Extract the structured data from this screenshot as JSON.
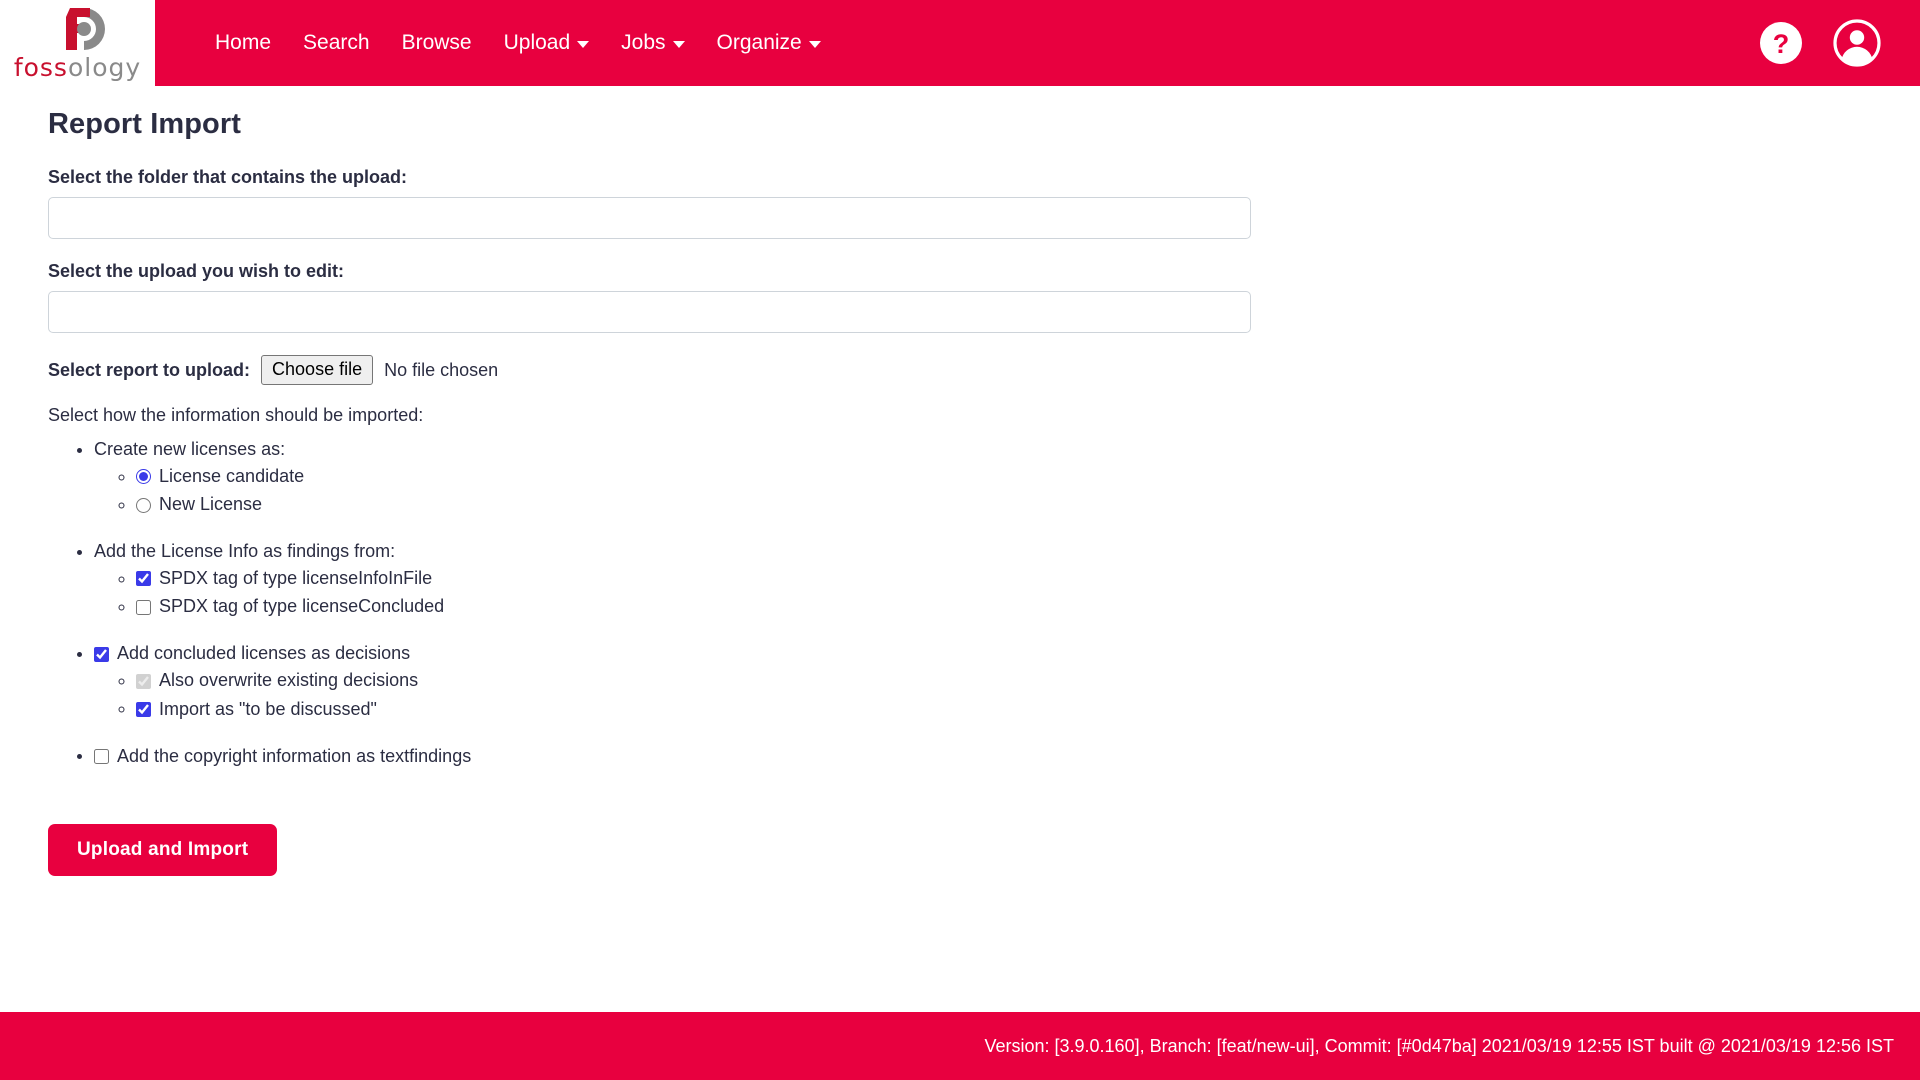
{
  "header": {
    "brand": {
      "logo_icon": "fossology-logo-icon",
      "word_red": "foss",
      "word_gray": "ology"
    },
    "nav": [
      {
        "label": "Home",
        "has_caret": false,
        "name": "nav-item-home"
      },
      {
        "label": "Search",
        "has_caret": false,
        "name": "nav-item-search"
      },
      {
        "label": "Browse",
        "has_caret": false,
        "name": "nav-item-browse"
      },
      {
        "label": "Upload",
        "has_caret": true,
        "name": "nav-item-upload"
      },
      {
        "label": "Jobs",
        "has_caret": true,
        "name": "nav-item-jobs"
      },
      {
        "label": "Organize",
        "has_caret": true,
        "name": "nav-item-organize"
      }
    ],
    "help_icon": "help-circle-icon",
    "user_icon": "user-account-icon"
  },
  "main": {
    "title": "Report Import",
    "folder_label": "Select the folder that contains the upload:",
    "folder_value": "",
    "folder_placeholder": "",
    "upload_label": "Select the upload you wish to edit:",
    "upload_value": "",
    "upload_placeholder": "",
    "report_label": "Select report to upload:",
    "choose_file_label": "Choose file",
    "file_status": "No file chosen",
    "import_intro": "Select how the information should be imported:",
    "options": {
      "create_licenses_label": "Create new licenses as:",
      "license_candidate": "License candidate",
      "new_license": "New License",
      "license_info_label": "Add the License Info as findings from:",
      "spdx_license_info_in_file": "SPDX tag of type licenseInfoInFile",
      "spdx_license_concluded": "SPDX tag of type licenseConcluded",
      "add_concluded": "Add concluded licenses as decisions",
      "also_overwrite": "Also overwrite existing decisions",
      "import_tbd": "Import as \"to be discussed\"",
      "copyright_textfindings": "Add the copyright information as textfindings"
    },
    "submit_label": "Upload and Import"
  },
  "footer": {
    "version_text": "Version: [3.9.0.160], Branch: [feat/new-ui], Commit: [#0d47ba] 2021/03/19 12:55 IST built @ 2021/03/19 12:56 IST"
  },
  "colors": {
    "brand_red": "#E8003F",
    "logo_red": "#C8102E",
    "logo_gray": "#8A8A8A",
    "text_dark": "#2B2D42",
    "accent_blue": "#3A3AE8",
    "input_border": "#ced4da"
  }
}
